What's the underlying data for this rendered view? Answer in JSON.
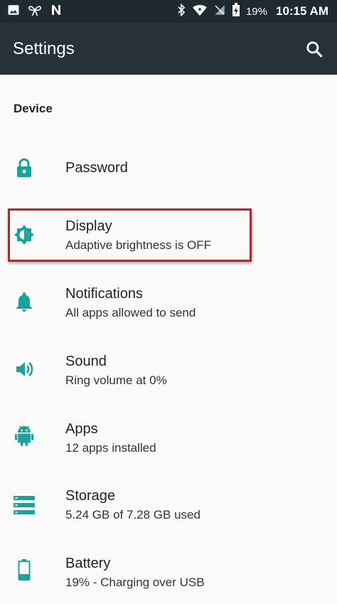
{
  "status_bar": {
    "battery_percent": "19%",
    "time": "10:15 AM",
    "left_icons": [
      "image-icon",
      "bow-icon",
      "n-logo-icon"
    ],
    "right_icons": [
      "bluetooth-icon",
      "wifi-icon",
      "no-sim-icon",
      "battery-charging-icon"
    ]
  },
  "toolbar": {
    "title": "Settings",
    "action_icon": "search-icon"
  },
  "section": {
    "title": "Device"
  },
  "accent_color": "#1aa39a",
  "items": [
    {
      "label": "Password",
      "subtitle": "",
      "icon": "lock-icon"
    },
    {
      "label": "Display",
      "subtitle": "Adaptive brightness is OFF",
      "icon": "brightness-icon"
    },
    {
      "label": "Notifications",
      "subtitle": "All apps allowed to send",
      "icon": "bell-icon"
    },
    {
      "label": "Sound",
      "subtitle": "Ring volume at 0%",
      "icon": "volume-icon"
    },
    {
      "label": "Apps",
      "subtitle": "12 apps installed",
      "icon": "android-icon"
    },
    {
      "label": "Storage",
      "subtitle": "5.24 GB of 7.28 GB used",
      "icon": "storage-icon"
    },
    {
      "label": "Battery",
      "subtitle": "19% - Charging over USB",
      "icon": "battery-icon"
    }
  ]
}
